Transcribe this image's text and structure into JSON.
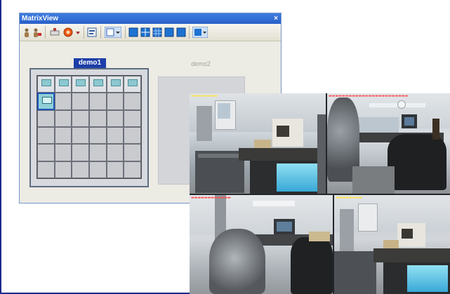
{
  "window": {
    "title": "MatrixView",
    "close_glyph": "×"
  },
  "toolbar": {
    "icons": [
      "user-icon",
      "user-remove-icon",
      "network-icon",
      "record-icon",
      "dropdown-arrow-icon",
      "properties-icon",
      "layout-select-icon",
      "layout-1x1-icon",
      "layout-2x2-icon",
      "layout-3x3-icon",
      "layout-4x4-icon",
      "layout-5x5-icon",
      "layout-custom-icon"
    ]
  },
  "matrices": [
    {
      "name": "demo1",
      "selected": true,
      "rows": 6,
      "cols": 6,
      "filled_cells": 7,
      "selected_cell": [
        1,
        0
      ]
    },
    {
      "name": "demo2",
      "selected": false
    }
  ],
  "cameras": [
    {
      "id": "cam1",
      "timestamp_color": "#ffe23a"
    },
    {
      "id": "cam2",
      "timestamp_color": "#ff4d4d"
    },
    {
      "id": "cam3",
      "timestamp_color": "#ff4d4d"
    },
    {
      "id": "cam4",
      "timestamp_color": "#ffe23a"
    }
  ],
  "colors": {
    "accent": "#1c3ea8",
    "titlebar": "#2a60c8",
    "border_edge": "#1f2a8a"
  }
}
